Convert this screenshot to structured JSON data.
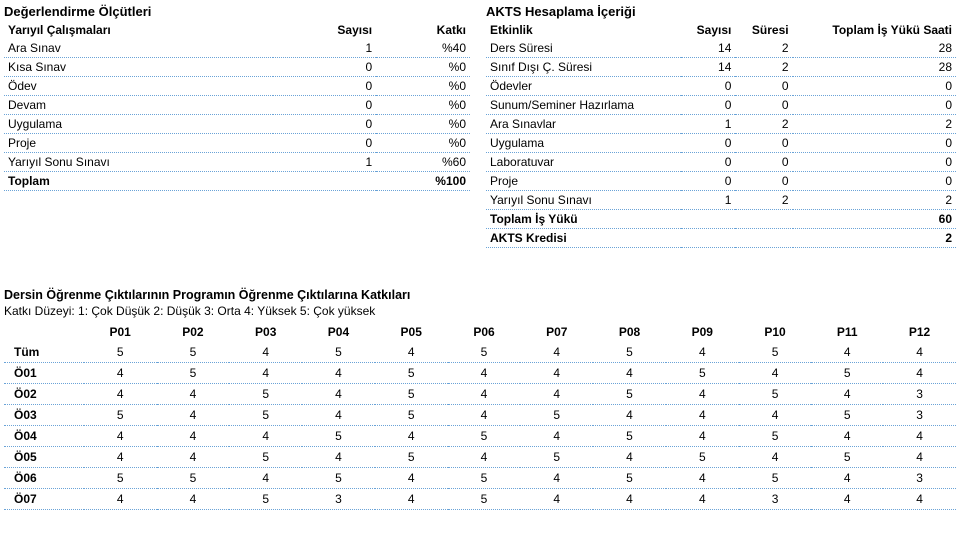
{
  "eval": {
    "title": "Değerlendirme Ölçütleri",
    "cols": [
      "Yarıyıl Çalışmaları",
      "Sayısı",
      "Katkı"
    ],
    "rows": [
      {
        "label": "Ara Sınav",
        "count": "1",
        "pct": "%40"
      },
      {
        "label": "Kısa Sınav",
        "count": "0",
        "pct": "%0"
      },
      {
        "label": "Ödev",
        "count": "0",
        "pct": "%0"
      },
      {
        "label": "Devam",
        "count": "0",
        "pct": "%0"
      },
      {
        "label": "Uygulama",
        "count": "0",
        "pct": "%0"
      },
      {
        "label": "Proje",
        "count": "0",
        "pct": "%0"
      },
      {
        "label": "Yarıyıl Sonu Sınavı",
        "count": "1",
        "pct": "%60"
      },
      {
        "label": "Toplam",
        "count": "",
        "pct": "%100",
        "bold": true
      }
    ]
  },
  "akts": {
    "title": "AKTS Hesaplama İçeriği",
    "cols": [
      "Etkinlik",
      "Sayısı",
      "Süresi",
      "Toplam İş Yükü Saati"
    ],
    "rows": [
      {
        "label": "Ders Süresi",
        "c": "14",
        "d": "2",
        "t": "28"
      },
      {
        "label": "Sınıf Dışı Ç. Süresi",
        "c": "14",
        "d": "2",
        "t": "28"
      },
      {
        "label": "Ödevler",
        "c": "0",
        "d": "0",
        "t": "0"
      },
      {
        "label": "Sunum/Seminer Hazırlama",
        "c": "0",
        "d": "0",
        "t": "0"
      },
      {
        "label": "Ara Sınavlar",
        "c": "1",
        "d": "2",
        "t": "2"
      },
      {
        "label": "Uygulama",
        "c": "0",
        "d": "0",
        "t": "0"
      },
      {
        "label": "Laboratuvar",
        "c": "0",
        "d": "0",
        "t": "0"
      },
      {
        "label": "Proje",
        "c": "0",
        "d": "0",
        "t": "0"
      },
      {
        "label": "Yarıyıl Sonu Sınavı",
        "c": "1",
        "d": "2",
        "t": "2"
      },
      {
        "label": "Toplam İş Yükü",
        "c": "",
        "d": "",
        "t": "60",
        "bold": true
      },
      {
        "label": "AKTS Kredisi",
        "c": "",
        "d": "",
        "t": "2",
        "bold": true
      }
    ]
  },
  "contrib": {
    "title": "Dersin Öğrenme Çıktılarının Programın Öğrenme Çıktılarına Katkıları",
    "sub": "Katkı Düzeyi: 1: Çok Düşük 2: Düşük 3: Orta 4: Yüksek 5: Çok yüksek",
    "header": [
      "",
      "P01",
      "P02",
      "P03",
      "P04",
      "P05",
      "P06",
      "P07",
      "P08",
      "P09",
      "P10",
      "P11",
      "P12"
    ],
    "rows": [
      {
        "label": "Tüm",
        "v": [
          "5",
          "5",
          "4",
          "5",
          "4",
          "5",
          "4",
          "5",
          "4",
          "5",
          "4",
          "4"
        ],
        "bold": true
      },
      {
        "label": "Ö01",
        "v": [
          "4",
          "5",
          "4",
          "4",
          "5",
          "4",
          "4",
          "4",
          "5",
          "4",
          "5",
          "4"
        ]
      },
      {
        "label": "Ö02",
        "v": [
          "4",
          "4",
          "5",
          "4",
          "5",
          "4",
          "4",
          "5",
          "4",
          "5",
          "4",
          "3"
        ]
      },
      {
        "label": "Ö03",
        "v": [
          "5",
          "4",
          "5",
          "4",
          "5",
          "4",
          "5",
          "4",
          "4",
          "4",
          "5",
          "3"
        ]
      },
      {
        "label": "Ö04",
        "v": [
          "4",
          "4",
          "4",
          "5",
          "4",
          "5",
          "4",
          "5",
          "4",
          "5",
          "4",
          "4"
        ]
      },
      {
        "label": "Ö05",
        "v": [
          "4",
          "4",
          "5",
          "4",
          "5",
          "4",
          "5",
          "4",
          "5",
          "4",
          "5",
          "4"
        ]
      },
      {
        "label": "Ö06",
        "v": [
          "5",
          "5",
          "4",
          "5",
          "4",
          "5",
          "4",
          "5",
          "4",
          "5",
          "4",
          "3"
        ]
      },
      {
        "label": "Ö07",
        "v": [
          "4",
          "4",
          "5",
          "3",
          "4",
          "5",
          "4",
          "4",
          "4",
          "3",
          "4",
          "4"
        ]
      }
    ]
  }
}
